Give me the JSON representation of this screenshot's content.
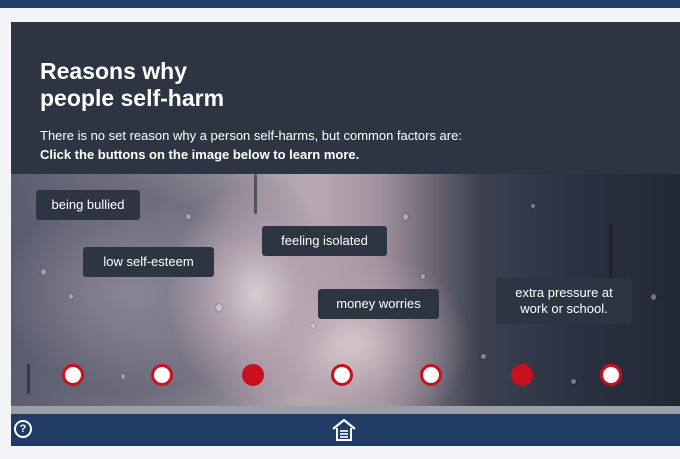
{
  "content": {
    "title": "Reasons why\npeople self-harm",
    "intro": "There is no set reason why a person self-harms, but common factors are:",
    "instruction": "Click the buttons on the image below to learn more."
  },
  "hotspots": {
    "labels": [
      "being bullied",
      "low self-esteem",
      "feeling isolated",
      "money worries",
      "extra pressure at\nwork or school."
    ]
  },
  "buttons": {
    "states": [
      "open",
      "open",
      "visited",
      "open",
      "open",
      "visited",
      "open"
    ]
  },
  "footer": {
    "help_icon": "question-mark-icon",
    "help_glyph": "?",
    "home_icon": "home-icon"
  },
  "colors": {
    "panel": "#2d3442",
    "nav": "#1f3b66",
    "accent": "#c8101e"
  }
}
